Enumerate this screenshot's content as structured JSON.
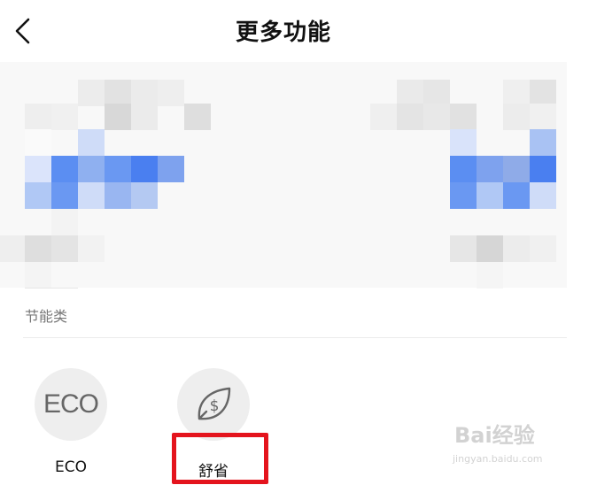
{
  "header": {
    "title": "更多功能",
    "back_icon": "chevron-left-icon"
  },
  "section": {
    "label": "节能类"
  },
  "features": [
    {
      "id": "eco",
      "label": "ECO",
      "icon_text": "ECO",
      "icon": "eco-text-icon"
    },
    {
      "id": "shusheng",
      "label": "舒省",
      "icon_text": "$",
      "icon": "leaf-dollar-icon"
    }
  ],
  "highlight": {
    "target": "舒省",
    "color": "#e4141d"
  },
  "watermark": {
    "main": "Bai经验",
    "sub": "jingyan.baidu.com"
  },
  "colors": {
    "accent": "#e4141d",
    "mosaic_blue": "#4a7ff0",
    "icon_bg": "#eeeeee",
    "section_text": "#777777"
  }
}
